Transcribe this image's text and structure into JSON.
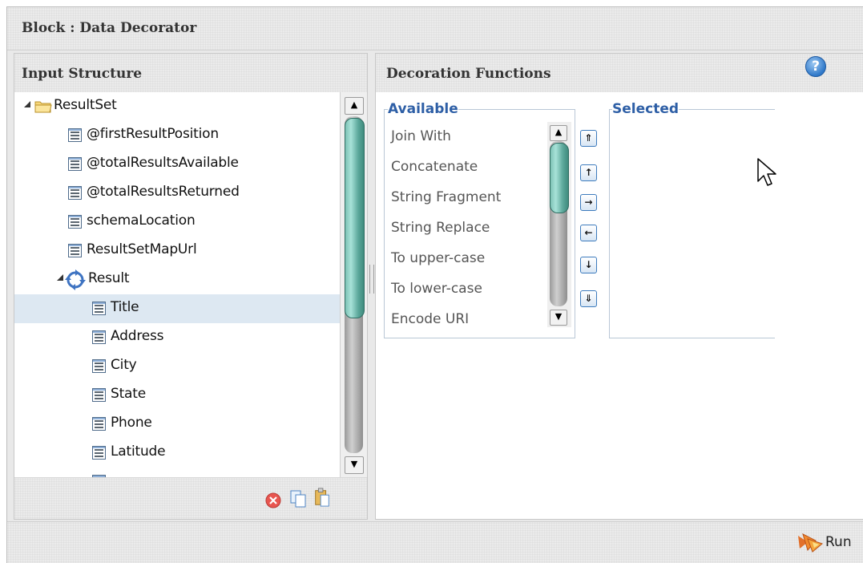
{
  "window": {
    "title": "Block : Data Decorator"
  },
  "input_structure": {
    "title": "Input Structure",
    "tree": [
      {
        "label": "ResultSet",
        "kind": "folder",
        "level": 0,
        "expanded": true
      },
      {
        "label": "@firstResultPosition",
        "kind": "field",
        "level": 1
      },
      {
        "label": "@totalResultsAvailable",
        "kind": "field",
        "level": 1
      },
      {
        "label": "@totalResultsReturned",
        "kind": "field",
        "level": 1
      },
      {
        "label": "schemaLocation",
        "kind": "field",
        "level": 1
      },
      {
        "label": "ResultSetMapUrl",
        "kind": "field",
        "level": 1
      },
      {
        "label": "Result",
        "kind": "loop",
        "level": 1,
        "expanded": true
      },
      {
        "label": "Title",
        "kind": "field",
        "level": 2,
        "selected": true
      },
      {
        "label": "Address",
        "kind": "field",
        "level": 2
      },
      {
        "label": "City",
        "kind": "field",
        "level": 2
      },
      {
        "label": "State",
        "kind": "field",
        "level": 2
      },
      {
        "label": "Phone",
        "kind": "field",
        "level": 2
      },
      {
        "label": "Latitude",
        "kind": "field",
        "level": 2
      }
    ],
    "footer_icons": [
      "delete-icon",
      "copy-icon",
      "paste-icon"
    ]
  },
  "decoration_functions": {
    "title": "Decoration Functions",
    "help_icon": "help-icon",
    "help_glyph": "?",
    "available_legend": "Available",
    "selected_legend": "Selected",
    "available": [
      "Join With",
      "Concatenate",
      "String Fragment",
      "String Replace",
      "To upper-case",
      "To lower-case",
      "Encode URI"
    ],
    "selected": [],
    "move_buttons": [
      {
        "name": "move-to-top-button",
        "glyph": "⇑"
      },
      {
        "name": "move-up-button",
        "glyph": "↑"
      },
      {
        "name": "add-button",
        "glyph": "→"
      },
      {
        "name": "remove-button",
        "glyph": "←"
      },
      {
        "name": "move-down-button",
        "glyph": "↓"
      },
      {
        "name": "move-to-bottom-button",
        "glyph": "⇓"
      }
    ]
  },
  "footer": {
    "run_label": "Run",
    "run_icon": "run-icon"
  },
  "colors": {
    "legend_blue": "#2e5fa6",
    "selection": "#dde8f2",
    "scroll_thumb": "#6fb8aa"
  }
}
